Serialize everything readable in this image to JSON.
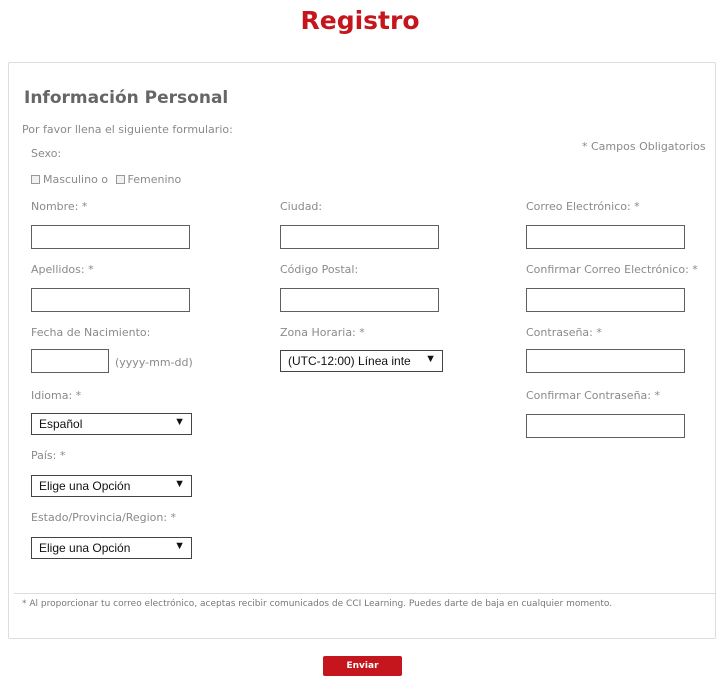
{
  "page": {
    "title": "Registro"
  },
  "form": {
    "section_title": "Información Personal",
    "intro": "Por favor llena el siguiente formulario:",
    "required_note": "* Campos Obligatorios",
    "sex": {
      "label": "Sexo:",
      "male": "Masculino o",
      "female": "Femenino"
    },
    "nombre": {
      "label": "Nombre: *",
      "value": ""
    },
    "apellidos": {
      "label": "Apellidos: *",
      "value": ""
    },
    "fecha": {
      "label": "Fecha de Nacimiento:",
      "value": "",
      "hint": "(yyyy-mm-dd)"
    },
    "idioma": {
      "label": "Idioma: *",
      "selected": "Español"
    },
    "pais": {
      "label": "País: *",
      "selected": "Elige una Opción"
    },
    "estado": {
      "label": "Estado/Provincia/Region: *",
      "selected": "Elige una Opción"
    },
    "ciudad": {
      "label": "Ciudad:",
      "value": ""
    },
    "codigo_postal": {
      "label": "Código Postal:",
      "value": ""
    },
    "zona_horaria": {
      "label": "Zona Horaria: *",
      "selected": "(UTC-12:00) Línea inte"
    },
    "correo": {
      "label": "Correo Electrónico: *",
      "value": ""
    },
    "confirmar_correo": {
      "label": "Confirmar Correo Electrónico: *",
      "value": ""
    },
    "contrasena": {
      "label": "Contraseña: *",
      "value": ""
    },
    "confirmar_contrasena": {
      "label": "Confirmar Contraseña: *",
      "value": ""
    },
    "footnote": "* Al proporcionar tu correo electrónico, aceptas recibir comunicados de CCI Learning. Puedes darte de baja en cualquier momento.",
    "submit_label": "Enviar"
  },
  "colors": {
    "accent": "#c4161c",
    "label": "#8a8a8a",
    "border": "#dddddd"
  },
  "icons": {
    "select_arrow": "triangle-down-icon"
  }
}
